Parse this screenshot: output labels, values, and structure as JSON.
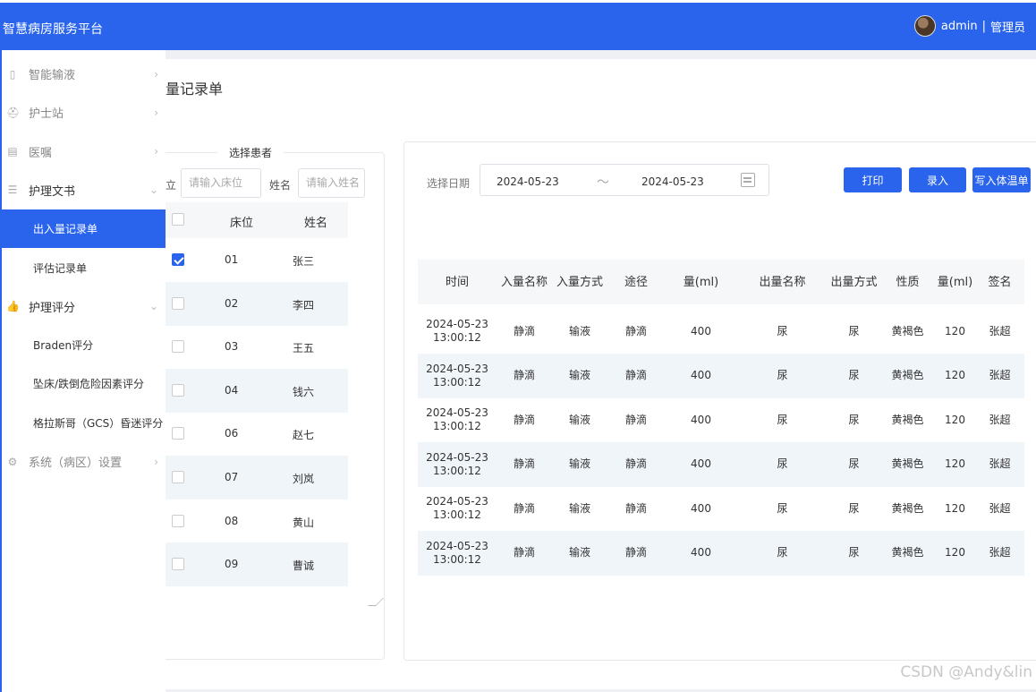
{
  "app": {
    "title": "智慧病房服务平台",
    "user": "admin",
    "role": "管理员"
  },
  "colors": {
    "primary": "#2a64ec",
    "alt_row": "#f0f5fa"
  },
  "sidebar": [
    {
      "label": "智能输液",
      "icon": "mobile-icon",
      "arrow": "›",
      "type": "item"
    },
    {
      "label": "护士站",
      "icon": "nurse-icon",
      "arrow": "›",
      "type": "item"
    },
    {
      "label": "医嘱",
      "icon": "document-icon",
      "arrow": "›",
      "type": "item"
    },
    {
      "label": "护理文书",
      "icon": "file-icon",
      "arrow": "⌄",
      "type": "item-open"
    },
    {
      "label": "出入量记录单",
      "type": "sub-active"
    },
    {
      "label": "评估记录单",
      "type": "sub"
    },
    {
      "label": "护理评分",
      "icon": "thumbs-up-icon",
      "arrow": "⌄",
      "type": "item-open"
    },
    {
      "label": "Braden评分",
      "type": "sub"
    },
    {
      "label": "坠床/跌倒危险因素评分",
      "type": "sub"
    },
    {
      "label": "格拉斯哥（GCS）昏迷评分",
      "type": "sub"
    },
    {
      "label": "系统（病区）设置",
      "icon": "gear-icon",
      "arrow": "›",
      "type": "item"
    }
  ],
  "page": {
    "title": "量记录单"
  },
  "patient_panel": {
    "legend": "选择患者",
    "bed_label": "立",
    "bed_placeholder": "请输入床位",
    "name_label": "姓名",
    "name_placeholder": "请输入姓名",
    "columns": [
      "床位",
      "姓名"
    ],
    "rows": [
      {
        "bed": "01",
        "name": "张三",
        "checked": true
      },
      {
        "bed": "02",
        "name": "李四",
        "checked": false
      },
      {
        "bed": "03",
        "name": "王五",
        "checked": false
      },
      {
        "bed": "04",
        "name": "钱六",
        "checked": false
      },
      {
        "bed": "06",
        "name": "赵七",
        "checked": false
      },
      {
        "bed": "07",
        "name": "刘岚",
        "checked": false
      },
      {
        "bed": "08",
        "name": "黄山",
        "checked": false
      },
      {
        "bed": "09",
        "name": "曹诚",
        "checked": false
      }
    ]
  },
  "records": {
    "date_label": "选择日期",
    "date_start": "2024-05-23",
    "date_sep": "～",
    "date_end": "2024-05-23",
    "buttons": {
      "print": "打印",
      "enter": "录入",
      "write_temp": "写入体温单"
    },
    "columns": [
      "时间",
      "入量名称",
      "入量方式",
      "途径",
      "量(ml)",
      "出量名称",
      "出量方式",
      "性质",
      "量(ml)",
      "签名"
    ],
    "rows": [
      [
        "2024-05-23 13:00:12",
        "静滴",
        "输液",
        "静滴",
        "400",
        "尿",
        "尿",
        "黄褐色",
        "120",
        "张超"
      ],
      [
        "2024-05-23 13:00:12",
        "静滴",
        "输液",
        "静滴",
        "400",
        "尿",
        "尿",
        "黄褐色",
        "120",
        "张超"
      ],
      [
        "2024-05-23 13:00:12",
        "静滴",
        "输液",
        "静滴",
        "400",
        "尿",
        "尿",
        "黄褐色",
        "120",
        "张超"
      ],
      [
        "2024-05-23 13:00:12",
        "静滴",
        "输液",
        "静滴",
        "400",
        "尿",
        "尿",
        "黄褐色",
        "120",
        "张超"
      ],
      [
        "2024-05-23 13:00:12",
        "静滴",
        "输液",
        "静滴",
        "400",
        "尿",
        "尿",
        "黄褐色",
        "120",
        "张超"
      ],
      [
        "2024-05-23 13:00:12",
        "静滴",
        "输液",
        "静滴",
        "400",
        "尿",
        "尿",
        "黄褐色",
        "120",
        "张超"
      ]
    ]
  },
  "watermark": "CSDN @Andy&lin"
}
